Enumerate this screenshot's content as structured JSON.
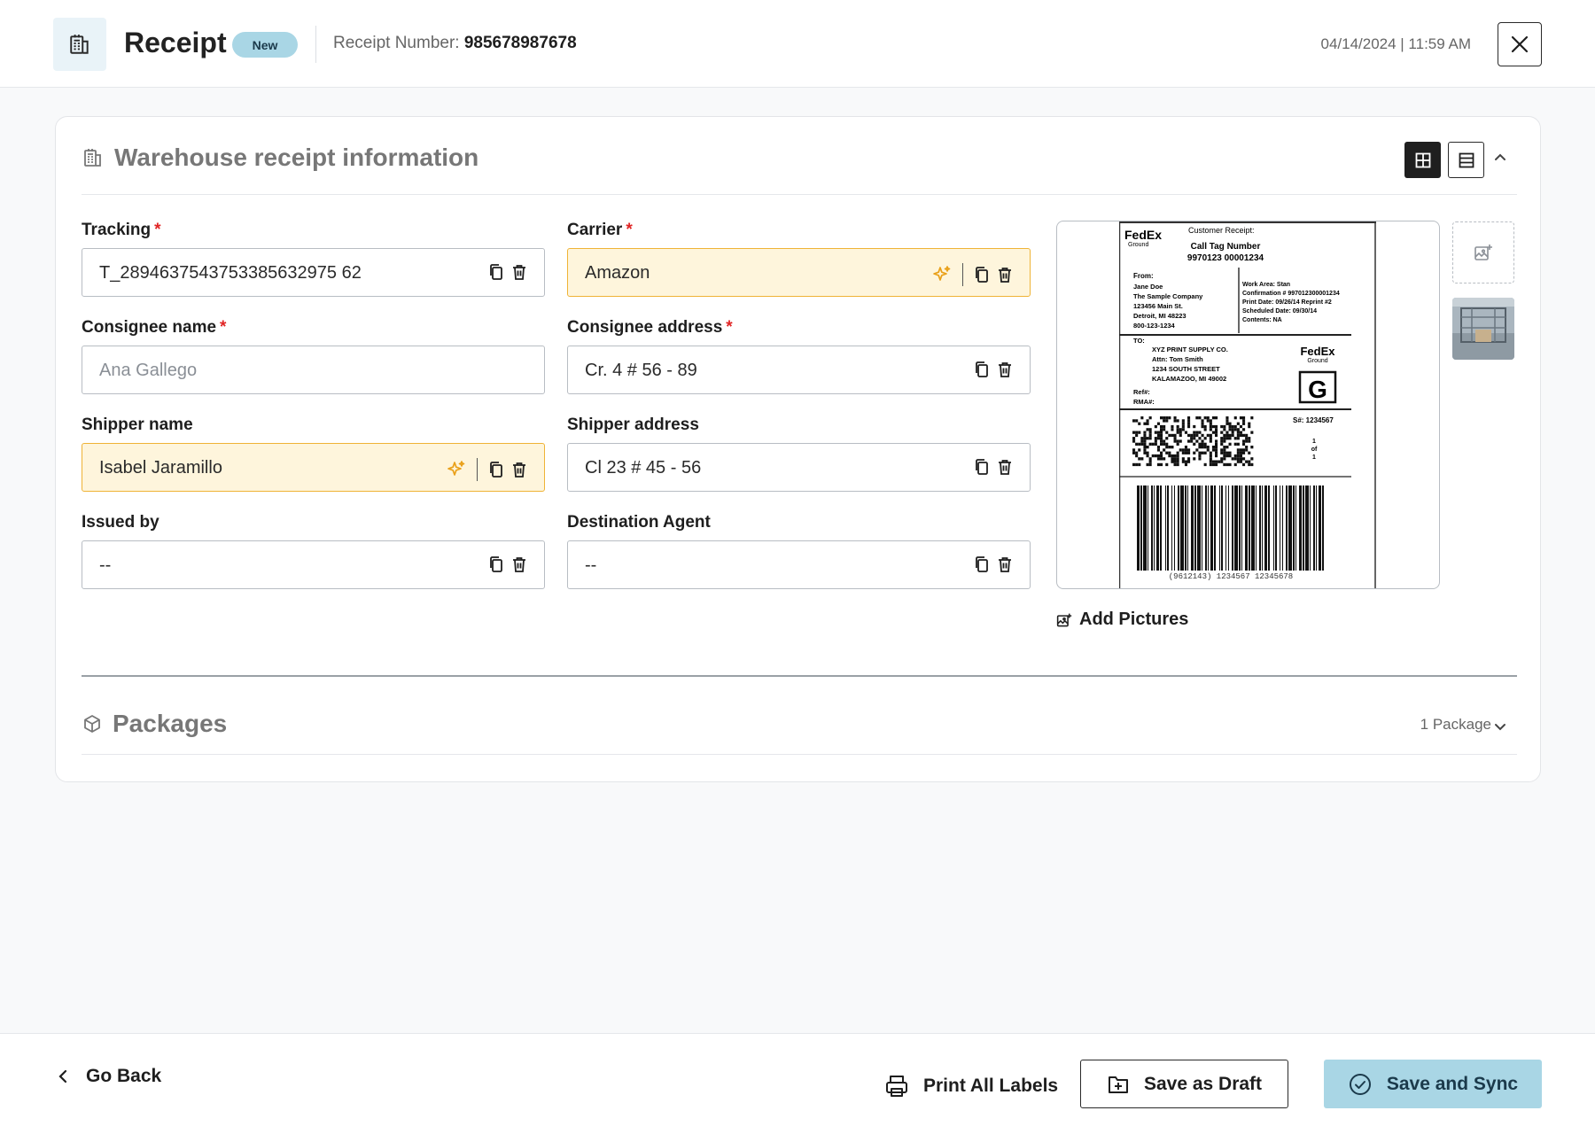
{
  "header": {
    "title": "Receipt",
    "badge": "New",
    "receipt_number_label": "Receipt Number:",
    "receipt_number": "985678987678",
    "datetime": "04/14/2024 | 11:59 AM"
  },
  "section": {
    "title": "Warehouse receipt information"
  },
  "fields": {
    "tracking": {
      "label": "Tracking",
      "required": "*",
      "value": "T_2894637543753385632975 62"
    },
    "carrier": {
      "label": "Carrier",
      "required": "*",
      "value": "Amazon"
    },
    "consignee_name": {
      "label": "Consignee name",
      "required": "*",
      "placeholder": "Ana Gallego"
    },
    "consignee_address": {
      "label": "Consignee address",
      "required": "*",
      "value": "Cr. 4 # 56 - 89"
    },
    "shipper_name": {
      "label": "Shipper name",
      "value": "Isabel Jaramillo"
    },
    "shipper_address": {
      "label": "Shipper address",
      "value": "Cl 23 # 45 - 56"
    },
    "issued_by": {
      "label": "Issued by",
      "value": "--"
    },
    "destination_agent": {
      "label": "Destination Agent",
      "value": "--"
    }
  },
  "shipping_label": {
    "brand": "FedEx",
    "brand_sub": "Ground",
    "customer_receipt": "Customer Receipt:",
    "call_tag_title": "Call Tag Number",
    "call_tag_number": "9970123  00001234",
    "from_label": "From:",
    "from_lines": [
      "Jane Doe",
      "The Sample Company",
      "123456 Main St.",
      "Detroit, MI 48223",
      "800-123-1234"
    ],
    "info_lines": [
      "Work Area:   Stan",
      "Confirmation # 997012300001234",
      "Print Date: 09/26/14   Reprint #2",
      "Scheduled Date:   09/30/14",
      "Contents:   NA"
    ],
    "to_label": "TO:",
    "to_lines": [
      "XYZ PRINT SUPPLY CO.",
      "Attn: Tom Smith",
      "1234 SOUTH STREET",
      "KALAMAZOO, MI 49002"
    ],
    "ref_lines": [
      "Ref#:",
      "RMA#:"
    ],
    "service_letter": "G",
    "sequence": "S#: 1234567",
    "piece_lines": [
      "1",
      "of",
      "1"
    ],
    "barcode_text": "(9612143) 1234567  12345678"
  },
  "media": {
    "add_pictures": "Add Pictures"
  },
  "packages": {
    "title": "Packages",
    "count": "1 Package"
  },
  "footer": {
    "go_back": "Go Back",
    "print_all": "Print All Labels",
    "save_draft": "Save as Draft",
    "save_sync": "Save and Sync"
  }
}
